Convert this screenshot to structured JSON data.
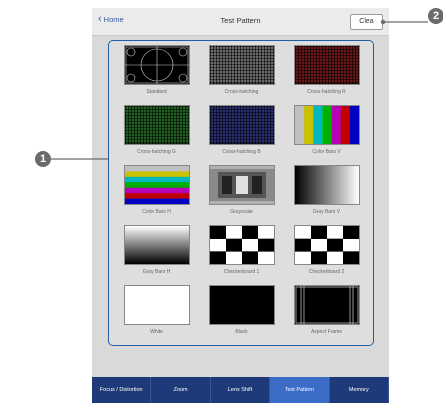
{
  "header": {
    "home_label": "Home",
    "title": "Test Pattern",
    "clear_label": "Clea"
  },
  "patterns": [
    {
      "label": "Standard",
      "kind": "standard"
    },
    {
      "label": "Cross-hatching",
      "kind": "hatch-white"
    },
    {
      "label": "Cross-hatching R",
      "kind": "hatch-red"
    },
    {
      "label": "Cross-hatching G",
      "kind": "hatch-green"
    },
    {
      "label": "Cross-hatching B",
      "kind": "hatch-blue"
    },
    {
      "label": "Color Bars V",
      "kind": "bars-v"
    },
    {
      "label": "Color Bars H",
      "kind": "bars-h"
    },
    {
      "label": "Grayscale",
      "kind": "grayscale"
    },
    {
      "label": "Gray Bars V",
      "kind": "gray-v"
    },
    {
      "label": "Gray Bars H",
      "kind": "gray-h"
    },
    {
      "label": "Checkerboard 1",
      "kind": "checker1"
    },
    {
      "label": "Checkerboard 2",
      "kind": "checker2"
    },
    {
      "label": "White",
      "kind": "white"
    },
    {
      "label": "Black",
      "kind": "black"
    },
    {
      "label": "Aspect Frame",
      "kind": "aspect"
    }
  ],
  "tabs": [
    {
      "label": "Focus / Distortion",
      "active": false
    },
    {
      "label": "Zoom",
      "active": false
    },
    {
      "label": "Lens Shift",
      "active": false
    },
    {
      "label": "Test Pattern",
      "active": true
    },
    {
      "label": "Memory",
      "active": false
    }
  ],
  "callouts": {
    "one": "1",
    "two": "2"
  },
  "colors": {
    "accent": "#1f5fa8",
    "tabbar": "#1f3a78",
    "active_tab": "#3a6cc8"
  }
}
